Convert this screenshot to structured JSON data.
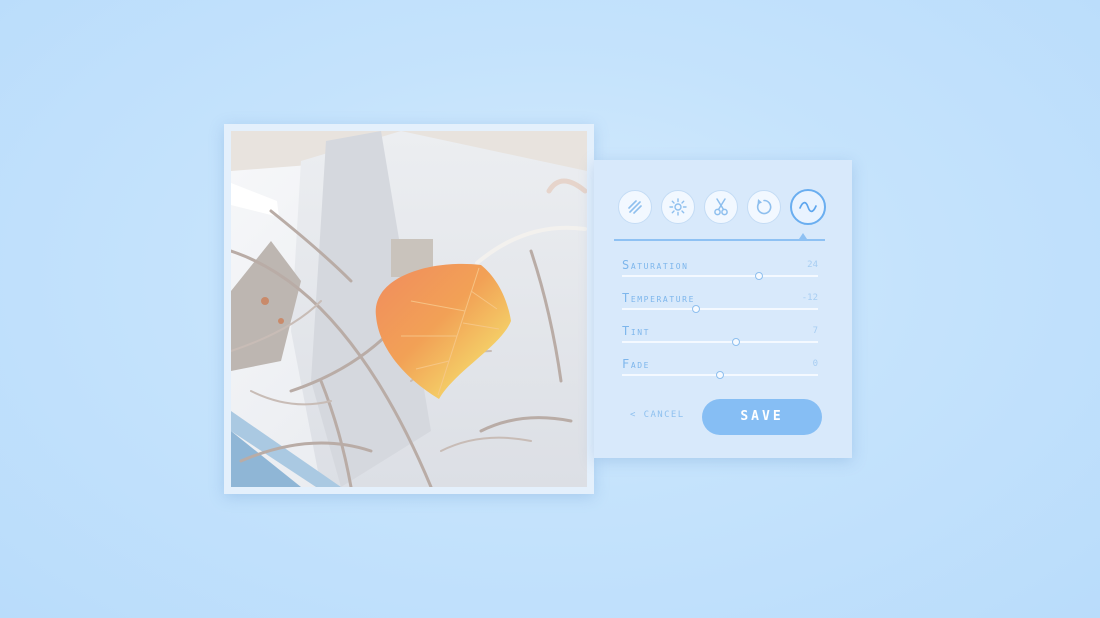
{
  "photo": {
    "subject": "leaf-photo"
  },
  "toolbar": {
    "tools": [
      {
        "icon": "filter-lines-icon",
        "active": false
      },
      {
        "icon": "brightness-icon",
        "active": false
      },
      {
        "icon": "scissors-icon",
        "active": false
      },
      {
        "icon": "rotate-icon",
        "active": false
      },
      {
        "icon": "curve-wave-icon",
        "active": true
      }
    ]
  },
  "sliders": [
    {
      "label": "Saturation",
      "value": "24",
      "level": 0.7
    },
    {
      "label": "Temperature",
      "value": "-12",
      "level": 0.38
    },
    {
      "label": "Tint",
      "value": "7",
      "level": 0.58
    },
    {
      "label": "Fade",
      "value": "0",
      "level": 0.5
    }
  ],
  "actions": {
    "cancel_label": "< CANCEL",
    "save_label": "SAVE"
  },
  "colors": {
    "background": "#c5e3fc",
    "panel": "#d8e9fb",
    "accent": "#86bef4",
    "label": "#7db6ec"
  }
}
